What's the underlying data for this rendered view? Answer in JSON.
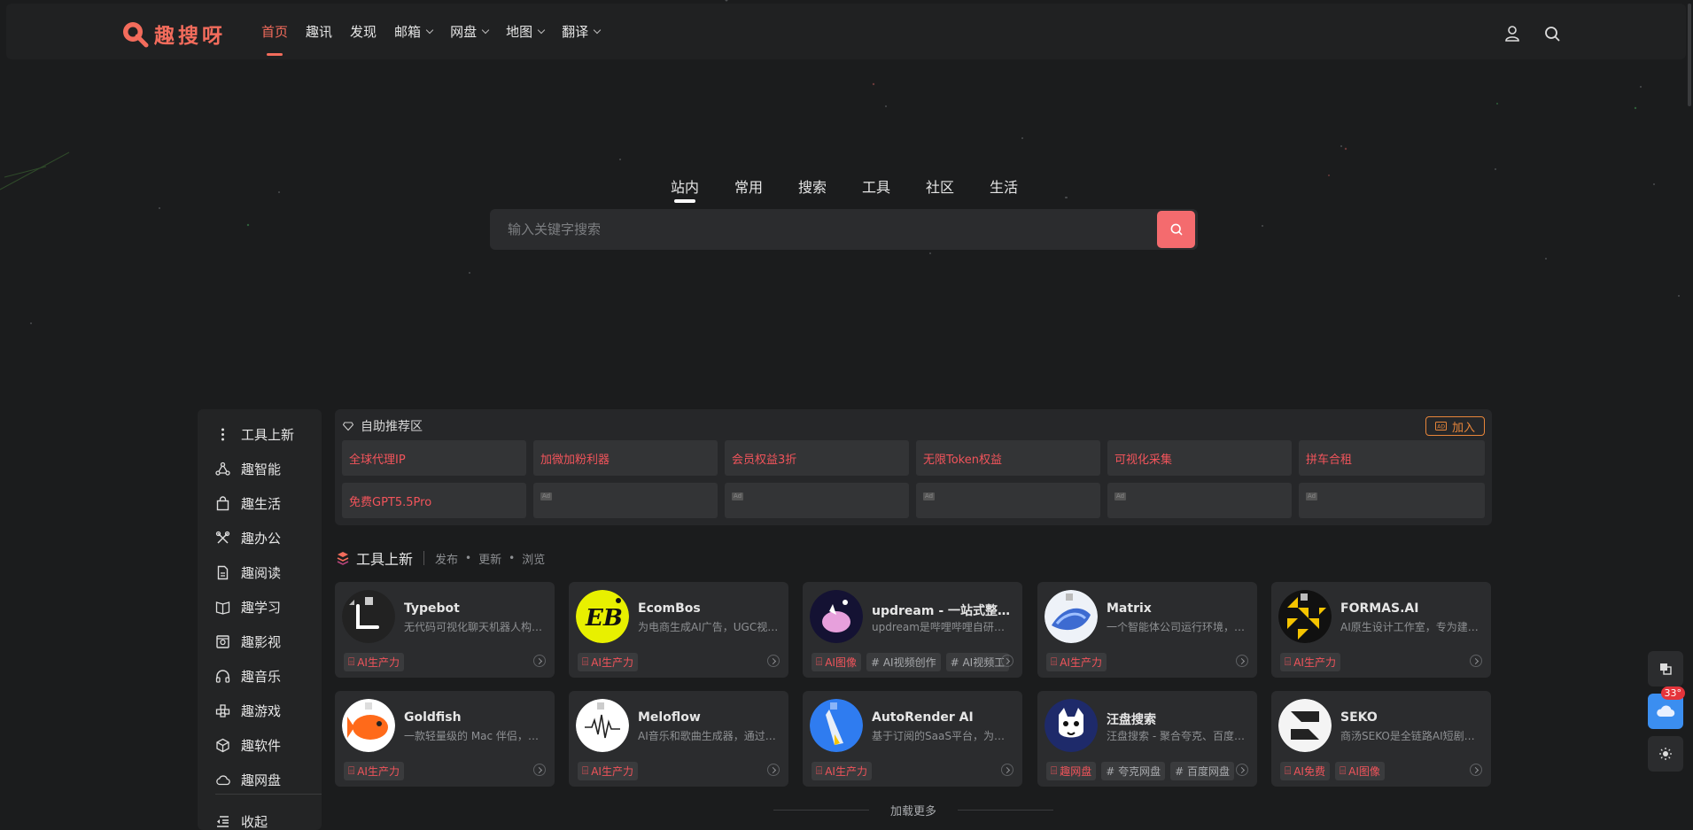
{
  "brand": {
    "name": "趣搜呀",
    "accent": "#f36c5c"
  },
  "nav": [
    {
      "label": "首页",
      "active": true,
      "dropdown": false
    },
    {
      "label": "趣讯",
      "dropdown": false
    },
    {
      "label": "发现",
      "dropdown": false
    },
    {
      "label": "邮箱",
      "dropdown": true
    },
    {
      "label": "网盘",
      "dropdown": true
    },
    {
      "label": "地图",
      "dropdown": true
    },
    {
      "label": "翻译",
      "dropdown": true
    }
  ],
  "header_icons": [
    "user-icon",
    "search-icon"
  ],
  "search": {
    "tabs": [
      "站内",
      "常用",
      "搜索",
      "工具",
      "社区",
      "生活"
    ],
    "active_tab": "站内",
    "placeholder": "输入关键字搜索"
  },
  "sidebar": [
    {
      "label": "工具上新",
      "icon": "more-vertical-icon"
    },
    {
      "label": "趣智能",
      "icon": "network-icon"
    },
    {
      "label": "趣生活",
      "icon": "bag-icon"
    },
    {
      "label": "趣办公",
      "icon": "tools-icon"
    },
    {
      "label": "趣阅读",
      "icon": "document-icon"
    },
    {
      "label": "趣学习",
      "icon": "book-icon"
    },
    {
      "label": "趣影视",
      "icon": "film-icon"
    },
    {
      "label": "趣音乐",
      "icon": "headphones-icon"
    },
    {
      "label": "趣游戏",
      "icon": "gamepad-icon"
    },
    {
      "label": "趣软件",
      "icon": "box-icon"
    },
    {
      "label": "趣网盘",
      "icon": "cloud-icon"
    },
    {
      "label": "收起",
      "icon": "collapse-icon"
    }
  ],
  "ads": {
    "title": "自助推荐区",
    "join_label": "加入",
    "items": [
      "全球代理IP",
      "加微加粉利器",
      "会员权益3折",
      "无限Token权益",
      "可视化采集",
      "拼车合租",
      "免费GPT5.5Pro",
      "",
      "",
      "",
      "",
      ""
    ],
    "empty_tag": "Ad"
  },
  "section": {
    "title": "工具上新",
    "meta": [
      "发布",
      "更新",
      "浏览"
    ]
  },
  "cards": [
    {
      "name": "Typebot",
      "desc": "无代码可视化聊天机器人构建器",
      "tags": [
        {
          "t": "AI生产力",
          "red": true
        }
      ]
    },
    {
      "name": "EcomBos",
      "desc": "为电商生成AI广告，UGC视频等",
      "tags": [
        {
          "t": "AI生产力",
          "red": true
        }
      ]
    },
    {
      "name": "updream - 一站式整合型AI创作平台",
      "desc": "updream是哔哩哔哩自研的AI平台",
      "tags": [
        {
          "t": "AI图像",
          "red": true
        },
        {
          "t": "# AI视频创作",
          "red": false
        },
        {
          "t": "# AI视频工",
          "red": false
        }
      ]
    },
    {
      "name": "Matrix",
      "desc": "一个智能体公司运行环境，支持多",
      "tags": [
        {
          "t": "AI生产力",
          "red": true
        }
      ]
    },
    {
      "name": "FORMAS.AI",
      "desc": "AI原生设计工作室，专为建筑设计",
      "tags": [
        {
          "t": "AI生产力",
          "red": true
        }
      ]
    },
    {
      "name": "Goldfish",
      "desc": "一款轻量级的 Mac 伴侣，帮助用户",
      "tags": [
        {
          "t": "AI生产力",
          "red": true
        }
      ]
    },
    {
      "name": "Meloflow",
      "desc": "AI音乐和歌曲生成器，通过文字描述",
      "tags": [
        {
          "t": "AI生产力",
          "red": true
        }
      ]
    },
    {
      "name": "AutoRender AI",
      "desc": "基于订阅的SaaS平台，为建筑师提供",
      "tags": [
        {
          "t": "AI生产力",
          "red": true
        }
      ]
    },
    {
      "name": "汪盘搜索",
      "desc": "汪盘搜索 - 聚合夸克、百度网盘资源",
      "tags": [
        {
          "t": "趣网盘",
          "red": true
        },
        {
          "t": "# 夸克网盘",
          "red": false
        },
        {
          "t": "# 百度网盘",
          "red": false
        }
      ]
    },
    {
      "name": "SEKO",
      "desc": "商汤SEKO是全链路AI短剧创作平台",
      "tags": [
        {
          "t": "AI免费",
          "red": true
        },
        {
          "t": "AI图像",
          "red": true
        }
      ]
    }
  ],
  "load_more": "加载更多",
  "weather": {
    "temp": "33°"
  }
}
